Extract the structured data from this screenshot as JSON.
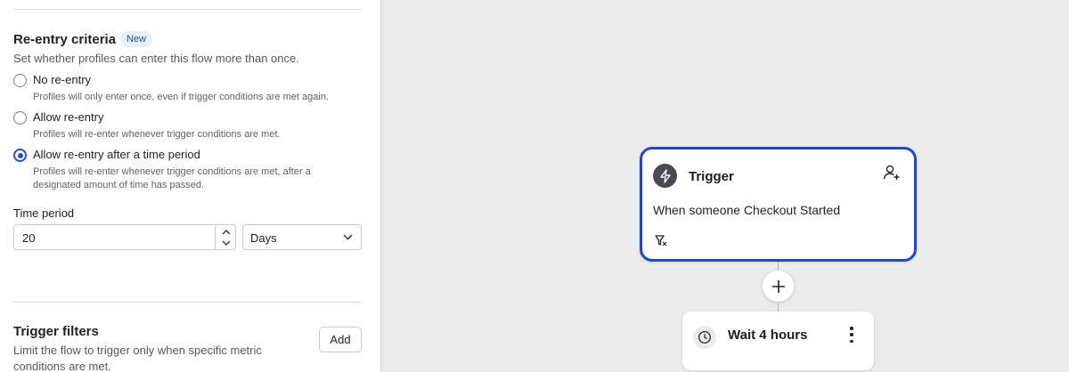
{
  "reentry": {
    "title": "Re-entry criteria",
    "badge": "New",
    "description": "Set whether profiles can enter this flow more than once.",
    "options": [
      {
        "label": "No re-entry",
        "description": "Profiles will only enter once, even if trigger conditions are met again.",
        "selected": false
      },
      {
        "label": "Allow re-entry",
        "description": "Profiles will re-enter whenever trigger conditions are met.",
        "selected": false
      },
      {
        "label": "Allow re-entry after a time period",
        "description": "Profiles will re-enter whenever trigger conditions are met, after a designated amount of time has passed.",
        "selected": true
      }
    ],
    "time_period": {
      "label": "Time period",
      "value": "20",
      "unit": "Days"
    }
  },
  "trigger_filters": {
    "title": "Trigger filters",
    "description": "Limit the flow to trigger only when specific metric conditions are met.",
    "add_label": "Add"
  },
  "canvas": {
    "trigger": {
      "title": "Trigger",
      "description": "When someone Checkout Started",
      "icon": "lightning-icon",
      "action_icon": "user-add-icon",
      "filter_icon": "filter-icon"
    },
    "add_step_icon": "plus-icon",
    "wait": {
      "title": "Wait 4 hours",
      "icon": "clock-icon",
      "menu_icon": "kebab-menu-icon"
    }
  },
  "colors": {
    "accent": "#2347c0",
    "radio_selected": "#2b4fc1",
    "badge_bg": "#e6f0fb",
    "canvas_bg": "#ebebec"
  }
}
